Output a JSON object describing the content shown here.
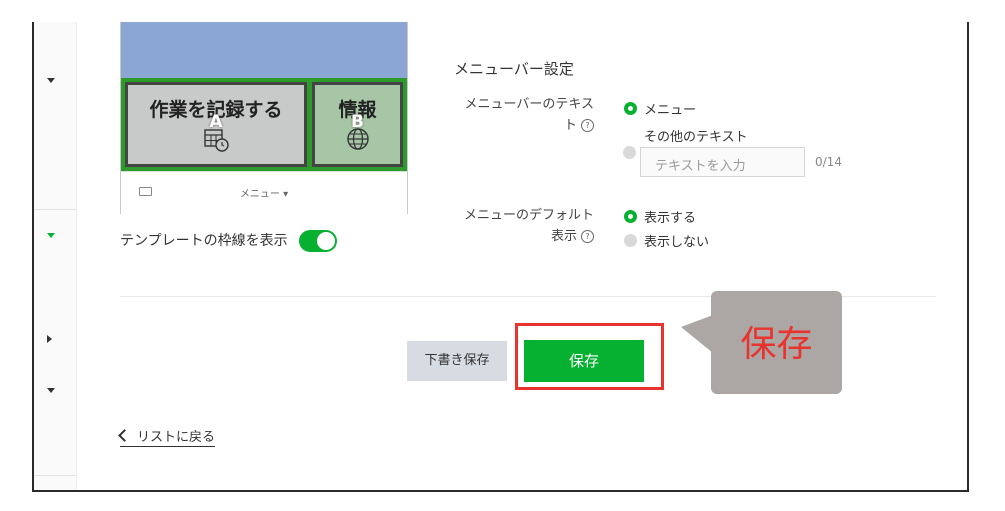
{
  "preview": {
    "cells": [
      {
        "title": "作業を記録する",
        "letter": "A",
        "icon": "calendar-clock-icon"
      },
      {
        "title": "情報",
        "letter": "B",
        "icon": "globe-icon"
      }
    ],
    "menu_label": "メニュー ▾",
    "keyboard_icon": "keyboard-icon"
  },
  "template_border": {
    "label": "テンプレートの枠線を表示",
    "enabled": true
  },
  "menubar_settings": {
    "title": "メニューバー設定",
    "text_label_line1": "メニューバーのテキス",
    "text_label_line2": "ト",
    "text_options": [
      {
        "label": "メニュー",
        "selected": true
      },
      {
        "label": "その他のテキスト",
        "selected": false
      }
    ],
    "input_placeholder": "テキストを入力",
    "counter": "0/14",
    "default_label_line1": "メニューのデフォルト",
    "default_label_line2": "表示",
    "default_options": [
      {
        "label": "表示する",
        "selected": true
      },
      {
        "label": "表示しない",
        "selected": false
      }
    ],
    "help_glyph": "?"
  },
  "buttons": {
    "draft": "下書き保存",
    "save": "保存"
  },
  "callout": {
    "text": "保存"
  },
  "back_link": "リストに戻る",
  "colors": {
    "accent_green": "#06b030",
    "highlight_red": "#e8342f",
    "callout_bg": "#aca6a5"
  }
}
